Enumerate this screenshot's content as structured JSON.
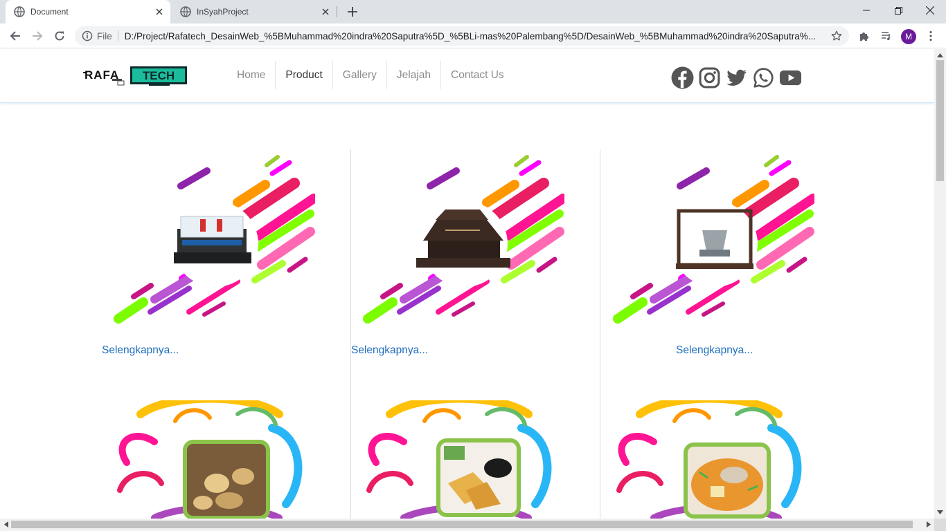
{
  "browser": {
    "tabs": [
      {
        "title": "Document",
        "active": true
      },
      {
        "title": "InSyahProject",
        "active": false
      }
    ],
    "url_scheme_label": "File",
    "url": "D:/Project/Rafatech_DesainWeb_%5BMuhammad%20indra%20Saputra%5D_%5BLi-mas%20Palembang%5D/DesainWeb_%5BMuhammad%20indra%20Saputra%...",
    "profile_initial": "M"
  },
  "site": {
    "logo_text": "RAFA TECH",
    "nav": [
      {
        "label": "Home",
        "active": false
      },
      {
        "label": "Product",
        "active": true
      },
      {
        "label": "Gallery",
        "active": false
      },
      {
        "label": "Jelajah",
        "active": false
      },
      {
        "label": "Contact Us",
        "active": false
      }
    ],
    "social_icons": [
      "facebook-icon",
      "instagram-icon",
      "twitter-icon",
      "whatsapp-icon",
      "youtube-icon"
    ],
    "products": [
      {
        "link": "Selengkapnya...",
        "subject": "songket-display-case"
      },
      {
        "link": "Selengkapnya...",
        "subject": "limas-house-model"
      },
      {
        "link": "Selengkapnya...",
        "subject": "trophy-display-case"
      }
    ],
    "foods": [
      {
        "subject": "pempek-dish"
      },
      {
        "subject": "tahu-fried-dish"
      },
      {
        "subject": "pindang-soup"
      }
    ]
  },
  "colors": {
    "link": "#1f6fbf",
    "nav_active": "#333333",
    "nav_inactive": "#8c8c8c",
    "logo_accent": "#1abc9c"
  }
}
